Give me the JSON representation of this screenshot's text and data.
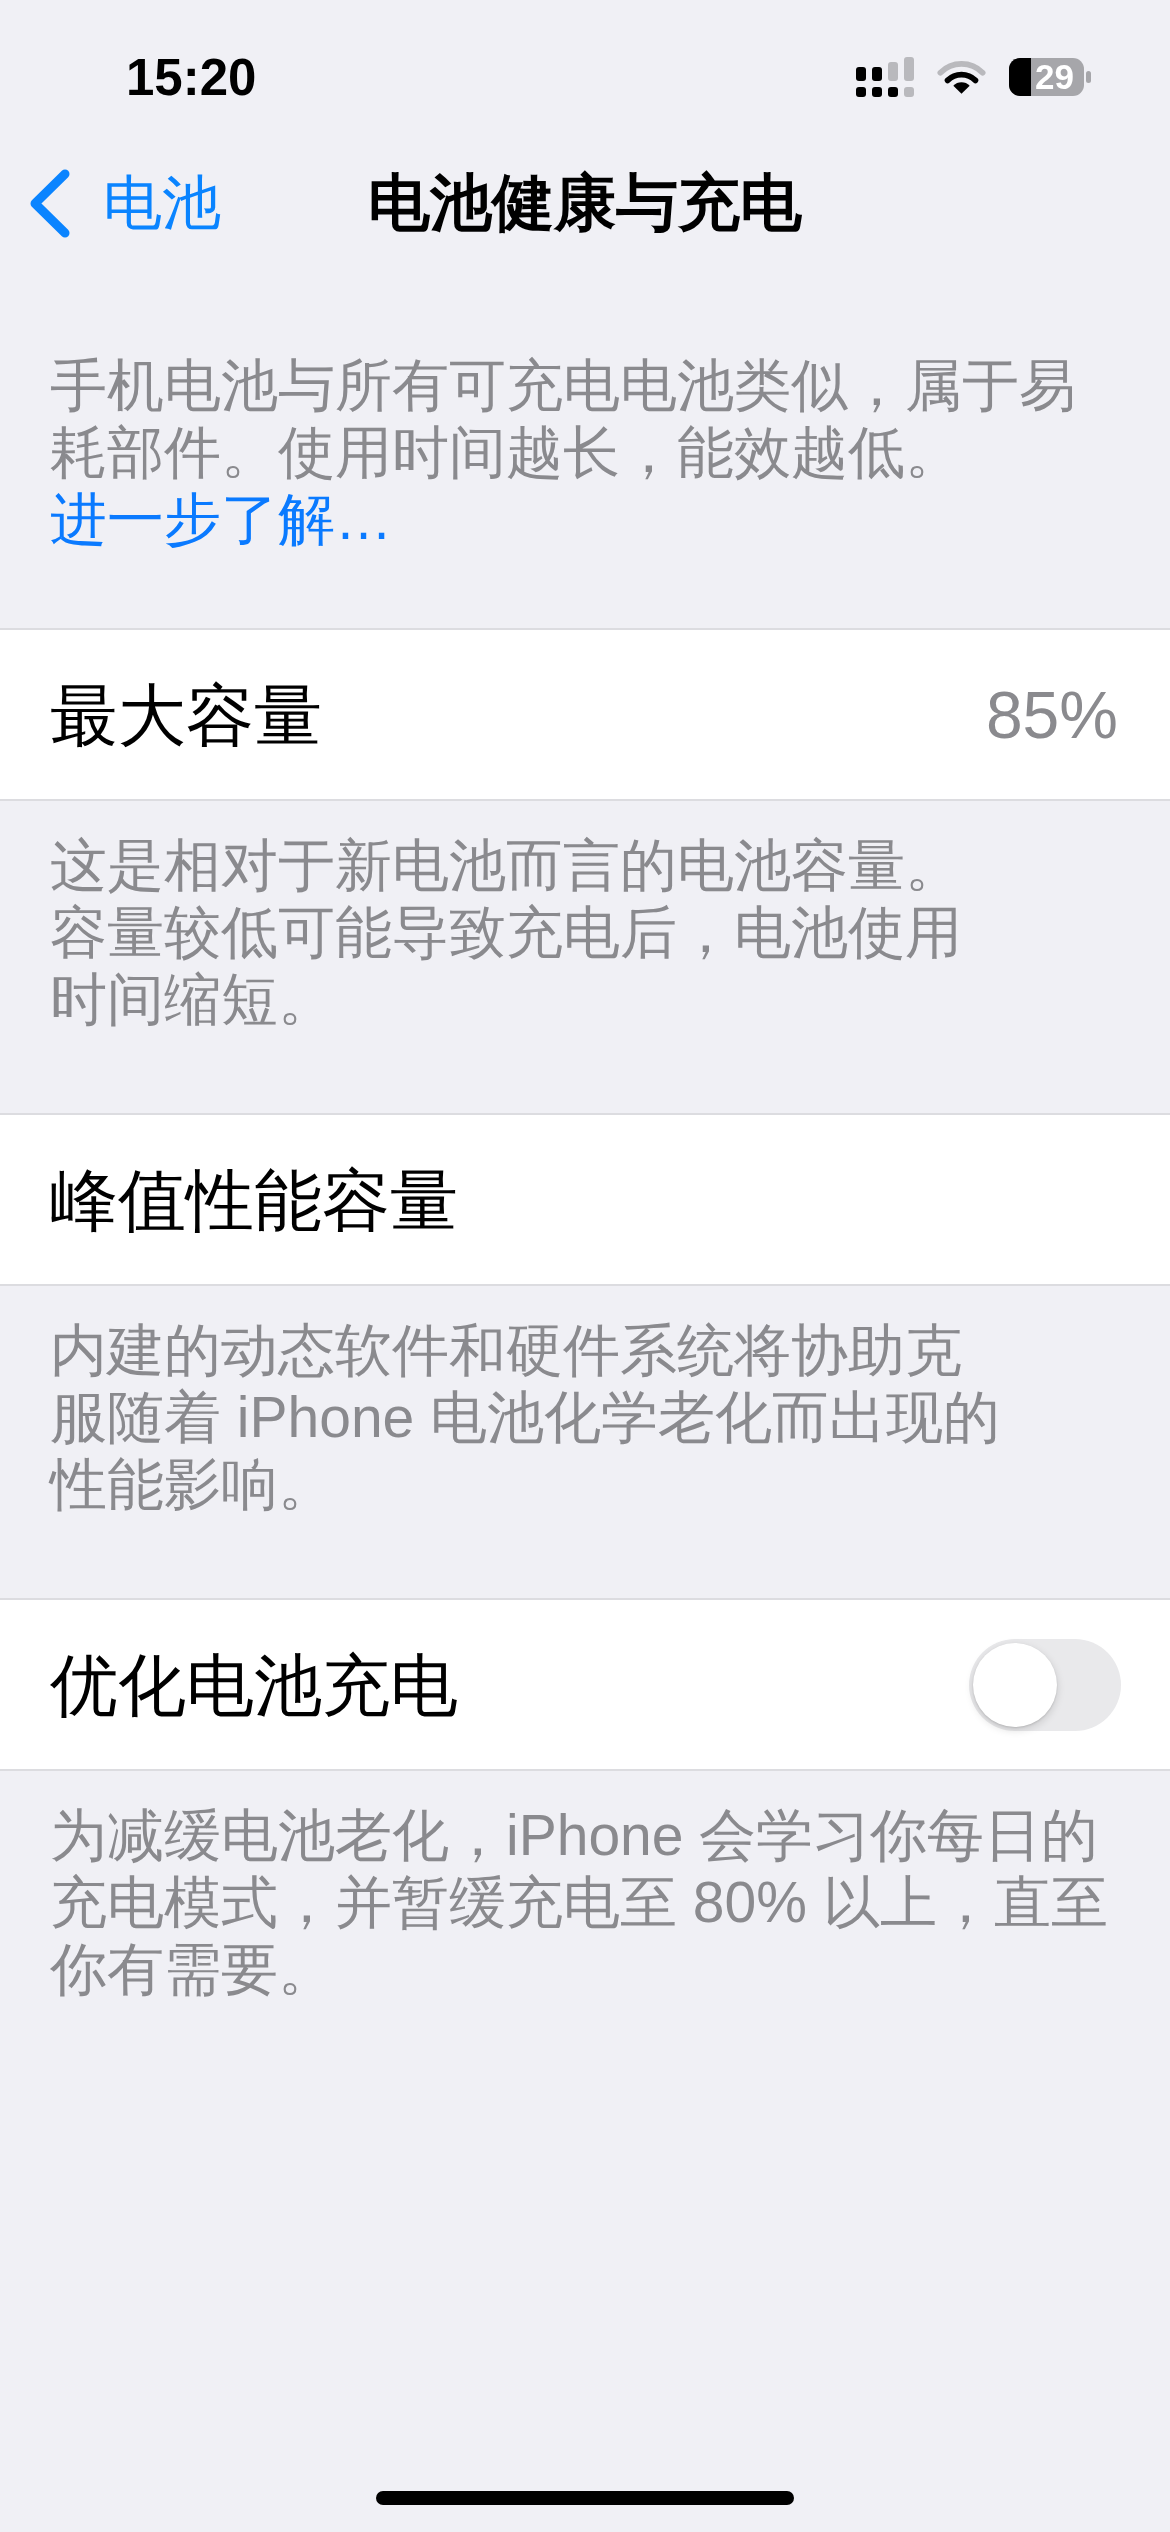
{
  "status_bar": {
    "time": "15:20",
    "battery": "29"
  },
  "nav": {
    "back": "电池",
    "title": "电池健康与充电"
  },
  "intro": {
    "text": "手机电池与所有可充电电池类似，属于易耗部件。使用时间越长，能效越低。",
    "link": "进一步了解…"
  },
  "sections": [
    {
      "row": {
        "kind": "value",
        "label": "最大容量",
        "value": "85%"
      },
      "footer": "这是相对于新电池而言的电池容量。容量较低可能导致充电后，电池使用时间缩短。"
    },
    {
      "row": {
        "kind": "plain",
        "label": "峰值性能容量"
      },
      "footer": "内建的动态软件和硬件系统将协助克服随着 iPhone 电池化学老化而出现的性能影响。"
    },
    {
      "row": {
        "kind": "toggle",
        "label": "优化电池充电",
        "on": false
      },
      "footer": "为减缓电池老化，iPhone 会学习你每日的充电模式，并暂缓充电至 80% 以上，直至你有需要。"
    }
  ]
}
